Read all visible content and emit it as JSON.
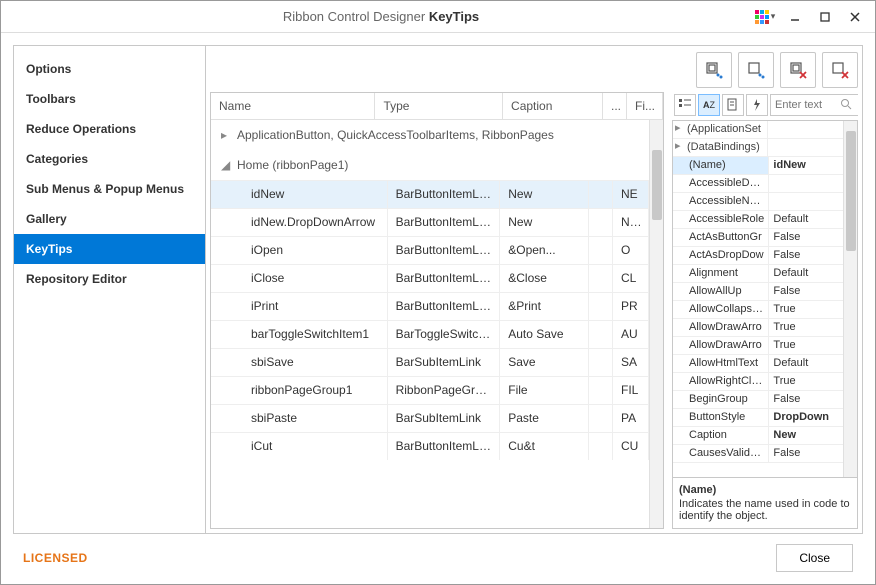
{
  "title_prefix": "Ribbon Control Designer ",
  "title_suffix": "KeyTips",
  "sidebar": {
    "items": [
      {
        "label": "Options"
      },
      {
        "label": "Toolbars"
      },
      {
        "label": "Reduce Operations"
      },
      {
        "label": "Categories"
      },
      {
        "label": "Sub Menus & Popup Menus"
      },
      {
        "label": "Gallery"
      },
      {
        "label": "KeyTips"
      },
      {
        "label": "Repository Editor"
      }
    ],
    "selected_index": 6
  },
  "table": {
    "columns": {
      "name": "Name",
      "type": "Type",
      "caption": "Caption",
      "dots": "...",
      "fi": "Fi..."
    },
    "group_closed": "ApplicationButton, QuickAccessToolbarItems, RibbonPages",
    "group_open": "Home (ribbonPage1)",
    "rows": [
      {
        "name": "idNew",
        "type": "BarButtonItemLink",
        "caption": "New",
        "fi": "NE"
      },
      {
        "name": "idNew.DropDownArrow",
        "type": "BarButtonItemLink",
        "caption": "New",
        "fi": "NW"
      },
      {
        "name": "iOpen",
        "type": "BarButtonItemLink",
        "caption": "&Open...",
        "fi": "O"
      },
      {
        "name": "iClose",
        "type": "BarButtonItemLink",
        "caption": "&Close",
        "fi": "CL"
      },
      {
        "name": "iPrint",
        "type": "BarButtonItemLink",
        "caption": "&Print",
        "fi": "PR"
      },
      {
        "name": "barToggleSwitchItem1",
        "type": "BarToggleSwitchIte...",
        "caption": "Auto Save",
        "fi": "AU"
      },
      {
        "name": "sbiSave",
        "type": "BarSubItemLink",
        "caption": "Save",
        "fi": "SA"
      },
      {
        "name": "ribbonPageGroup1",
        "type": "RibbonPageGroup",
        "caption": "File",
        "fi": "FIL"
      },
      {
        "name": "sbiPaste",
        "type": "BarSubItemLink",
        "caption": "Paste",
        "fi": "PA"
      },
      {
        "name": "iCut",
        "type": "BarButtonItemLink",
        "caption": "Cu&t",
        "fi": "CU"
      }
    ],
    "selected_row": 0
  },
  "props": {
    "search_placeholder": "Enter text",
    "rows": [
      {
        "k": "(ApplicationSet",
        "v": "",
        "cat": true,
        "exp": true
      },
      {
        "k": "(DataBindings)",
        "v": "",
        "cat": true,
        "exp": true
      },
      {
        "k": "(Name)",
        "v": "idNew",
        "selected": true
      },
      {
        "k": "AccessibleDesc",
        "v": ""
      },
      {
        "k": "AccessibleName",
        "v": ""
      },
      {
        "k": "AccessibleRole",
        "v": "Default"
      },
      {
        "k": "ActAsButtonGr",
        "v": "False"
      },
      {
        "k": "ActAsDropDow",
        "v": "False"
      },
      {
        "k": "Alignment",
        "v": "Default"
      },
      {
        "k": "AllowAllUp",
        "v": "False"
      },
      {
        "k": "AllowCollapseIr",
        "v": "True"
      },
      {
        "k": "AllowDrawArro",
        "v": "True"
      },
      {
        "k": "AllowDrawArro",
        "v": "True"
      },
      {
        "k": "AllowHtmlText",
        "v": "Default"
      },
      {
        "k": "AllowRightClick",
        "v": "True"
      },
      {
        "k": "BeginGroup",
        "v": "False"
      },
      {
        "k": "ButtonStyle",
        "v": "DropDown",
        "bold": true
      },
      {
        "k": "Caption",
        "v": "New",
        "bold": true
      },
      {
        "k": "CausesValidatic",
        "v": "False"
      }
    ],
    "desc": {
      "key": "(Name)",
      "text": "Indicates the name used in code to identify the object."
    }
  },
  "footer": {
    "licensed": "LICENSED",
    "close": "Close"
  }
}
